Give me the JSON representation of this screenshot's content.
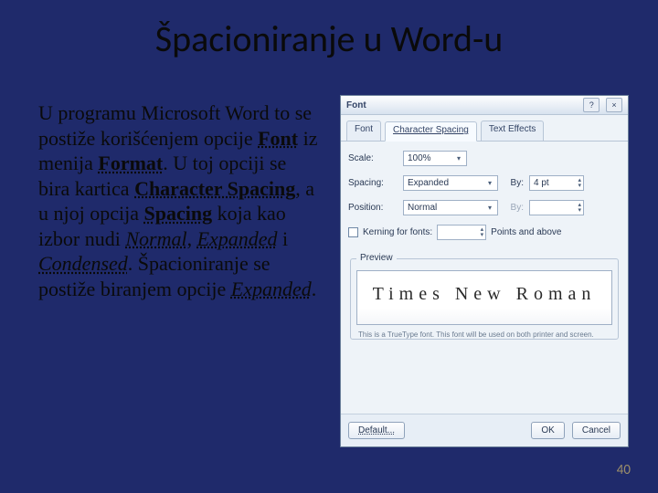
{
  "title": "Špacioniranje u Word-u",
  "paragraph": {
    "p1a": "U programu Microsoft Word to se postiže korišćenjem opcije ",
    "font_word": "Font",
    "p1b": " iz menija ",
    "format_word": "Format",
    "p1c": ". U toj opciji se bira kartica ",
    "charspacing_word": "Character Spacing",
    "p1d": ", a u njoj opcija ",
    "spacing_word": "Spacing",
    "p1e": " koja kao izbor nudi ",
    "normal_word": "Normal",
    "comma1": ", ",
    "expanded_word": "Expanded",
    "and_word": " i ",
    "condensed_word": "Condensed",
    "dot1": ". Špacioniranje se postiže biranjem opcije ",
    "expanded_word2": "Expanded",
    "dot2": "."
  },
  "dialog": {
    "title": "Font",
    "help": "?",
    "close": "×",
    "tabs": {
      "font": "Font",
      "charspacing": "Character Spacing",
      "texteffects": "Text Effects"
    },
    "scale_label": "Scale:",
    "scale_value": "100%",
    "spacing_label": "Spacing:",
    "spacing_value": "Expanded",
    "spacing_by_label": "By:",
    "spacing_by_value": "4 pt",
    "position_label": "Position:",
    "position_value": "Normal",
    "position_by_label": "By:",
    "position_by_value": "",
    "kerning_label": "Kerning for fonts:",
    "kerning_points_suffix": "Points and above",
    "preview_legend": "Preview",
    "preview_sample": "Times New Roman",
    "preview_note": "This is a TrueType font. This font will be used on both printer and screen.",
    "default_btn": "Default...",
    "ok_btn": "OK",
    "cancel_btn": "Cancel"
  },
  "page_number": "40"
}
